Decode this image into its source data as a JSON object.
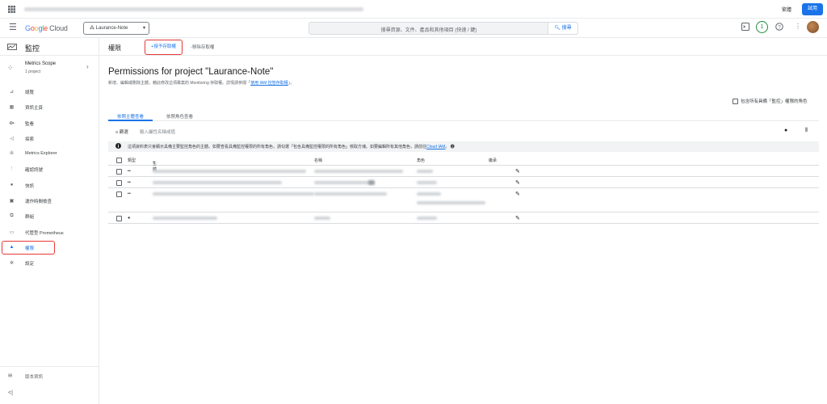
{
  "topbar": {
    "grid_icon": "apps-grid-icon",
    "language": "繁體",
    "try_button": "試用"
  },
  "header": {
    "logo": {
      "g1": "G",
      "g2": "o",
      "g3": "o",
      "g4": "g",
      "g5": "l",
      "g6": "e",
      "cloud": " Cloud"
    },
    "project_selector": "Laurance-Note",
    "search_placeholder": "搜尋資源、文件、產品和其他項目 (快速 / 鍵)",
    "search_button": "搜尋",
    "notification_count": "1"
  },
  "sidebar": {
    "title": "監控",
    "scope": {
      "name": "Metrics Scope",
      "sub": "1 project"
    },
    "items": [
      {
        "icon": "⊿",
        "label": "總覽",
        "name": "overview"
      },
      {
        "icon": "▦",
        "label": "資訊主頁",
        "name": "dashboards"
      },
      {
        "icon": "⟴",
        "label": "監看",
        "name": "monitor"
      },
      {
        "icon": "◁",
        "label": "探索",
        "name": "explore"
      },
      {
        "icon": "ılı",
        "label": "Metrics Explorer",
        "name": "metrics-explorer"
      },
      {
        "icon": "⫶",
        "label": "確認訊號",
        "name": "uptime"
      },
      {
        "icon": "●",
        "label": "快訊",
        "name": "alerting"
      },
      {
        "icon": "▣",
        "label": "運作時間檢查",
        "name": "uptime-checks"
      },
      {
        "icon": "⧉",
        "label": "群組",
        "name": "groups"
      },
      {
        "icon": "▭",
        "label": "代管型 Prometheus",
        "name": "prometheus"
      },
      {
        "icon": "▲",
        "label": "權限",
        "name": "permissions",
        "active": true
      },
      {
        "icon": "✲",
        "label": "設定",
        "name": "settings"
      }
    ],
    "release_notes": "版本資訊",
    "collapse_icon": "<|"
  },
  "main": {
    "page_title": "權限",
    "grant_button": "+授予存取權",
    "remove_button": "-移除存取權",
    "heading": "Permissions for project \"Laurance-Note\"",
    "description_prefix": "新增、編輯或刪除主體，藉此修改這項專案的 Monitoring 存取權。詳情請參閱「",
    "description_link": "使用 IAM 控管存取權",
    "description_suffix": "」。",
    "include_checkbox": "包含所有具備「監控」權限的角色",
    "tabs": [
      "依照主體查看",
      "依照角色查看"
    ],
    "filter_label": "篩選",
    "filter_placeholder": "輸入屬性名稱或值",
    "notice_text": "這項資料表只會顯示具備主要監控角色的主體。如要查看具備監控權限的所有角色，請勾選「包含具備監控權限的所有角色」核取方塊。如要編輯所有其他角色，請前往",
    "notice_link": "Cloud IAM",
    "notice_suffix": "。",
    "table_headers": {
      "type": "類型",
      "principal": "主體",
      "name": "名稱",
      "role": "角色",
      "inheritance": "繼承"
    },
    "rows": [
      {
        "type_icon": "▪▪",
        "type": "",
        "group": "1"
      },
      {
        "type_icon": "▪▪",
        "type": "",
        "group": "2"
      },
      {
        "type_icon": "▪▪",
        "type": "",
        "group": "3"
      },
      {
        "type_icon": "●",
        "type": "",
        "group": "4"
      }
    ]
  }
}
